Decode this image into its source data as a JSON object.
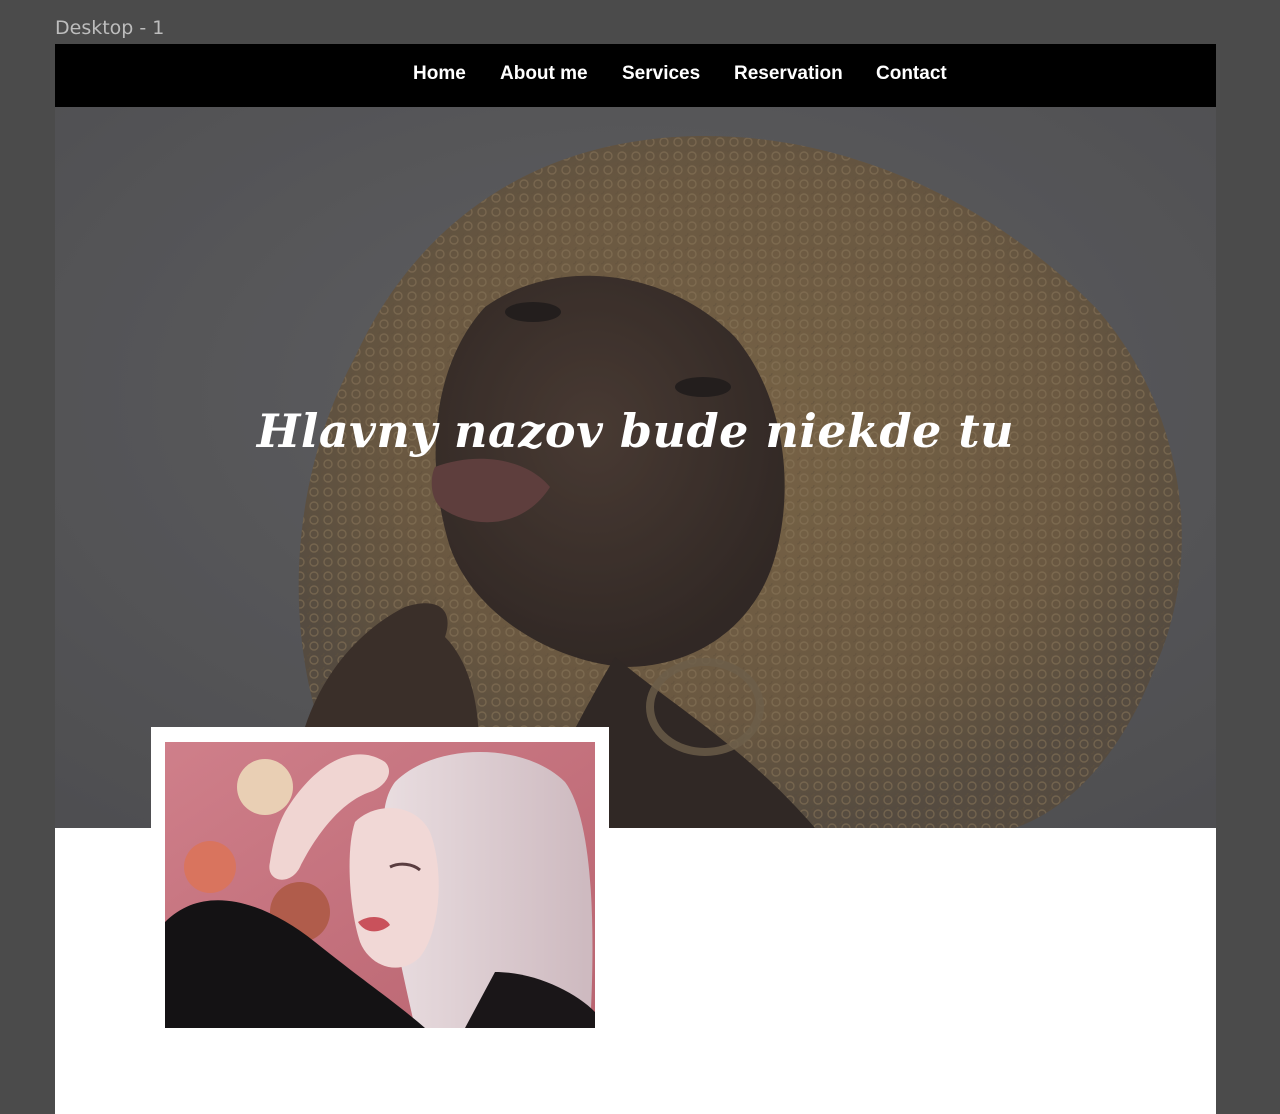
{
  "frame": {
    "label": "Desktop - 1"
  },
  "nav": {
    "items": [
      {
        "label": "Home"
      },
      {
        "label": "About me"
      },
      {
        "label": "Services"
      },
      {
        "label": "Reservation"
      },
      {
        "label": "Contact"
      }
    ]
  },
  "hero": {
    "title": "Hlavny nazov bude niekde tu",
    "image": "portrait-curly-hair-photo"
  },
  "feature_card": {
    "image": "portrait-pink-hair-photo"
  },
  "colors": {
    "canvas": "#4b4b4b",
    "nav_bg": "#000000",
    "nav_text": "#ffffff",
    "hero_overlay": "#5a5a5c",
    "page_bg": "#ffffff"
  }
}
